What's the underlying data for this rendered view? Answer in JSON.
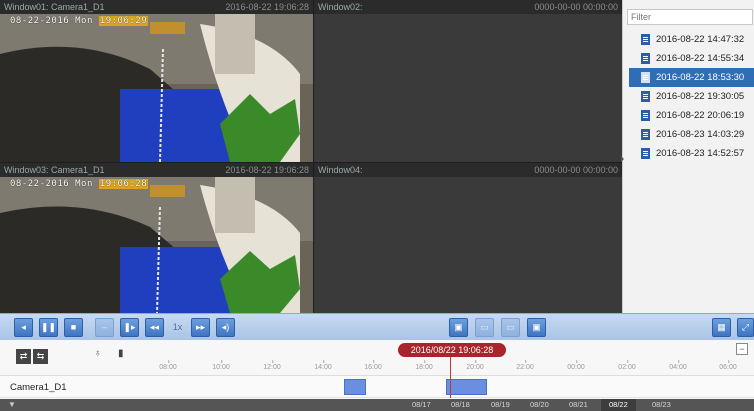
{
  "windows": [
    {
      "name": "Window01: Camera1_D1",
      "time": "2016-08-22 19:06:28",
      "osd_date": "08-22-2016 Mon",
      "osd_time": "19:06:29",
      "active": true
    },
    {
      "name": "Window02:",
      "time": "0000-00-00 00:00:00"
    },
    {
      "name": "Window03: Camera1_D1",
      "time": "2016-08-22 19:06:28",
      "osd_date": "08-22-2016 Mon",
      "osd_time": "19:06:28"
    },
    {
      "name": "Window04:",
      "time": "0000-00-00 00:00:00"
    }
  ],
  "sidebar": {
    "filter_placeholder": "Filter",
    "files": [
      {
        "label": "2016-08-22 14:47:32"
      },
      {
        "label": "2016-08-22 14:55:34"
      },
      {
        "label": "2016-08-22 18:53:30",
        "selected": true
      },
      {
        "label": "2016-08-22 19:30:05"
      },
      {
        "label": "2016-08-22 20:06:19"
      },
      {
        "label": "2016-08-23 14:03:29"
      },
      {
        "label": "2016-08-23 14:52:57"
      }
    ]
  },
  "controls": {
    "speed_label": "1x",
    "icons": [
      "prev-frame-icon",
      "pause-icon",
      "stop-icon",
      "slow-icon",
      "step-forward-icon",
      "rewind-icon",
      "fast-forward-icon",
      "audio-icon",
      "capture-icon",
      "clip-icon",
      "download-icon",
      "export-icon",
      "layout-icon",
      "fullscreen-icon"
    ]
  },
  "timeline": {
    "cursor_time": "2016/08/22 19:06:28",
    "ticks": [
      "08:00",
      "10:00",
      "12:00",
      "14:00",
      "16:00",
      "18:00",
      "20:00",
      "22:00",
      "00:00",
      "02:00",
      "04:00",
      "06:00"
    ],
    "camera_label": "Camera1_D1",
    "dates": [
      "08/17",
      "08/18",
      "08/19",
      "08/20",
      "08/21",
      "08/22",
      "08/23"
    ],
    "current_date": "08/22",
    "colors": {
      "segment": "#6b8fe0",
      "cursor": "#a8262b",
      "selected": "#2f6eb5"
    }
  }
}
